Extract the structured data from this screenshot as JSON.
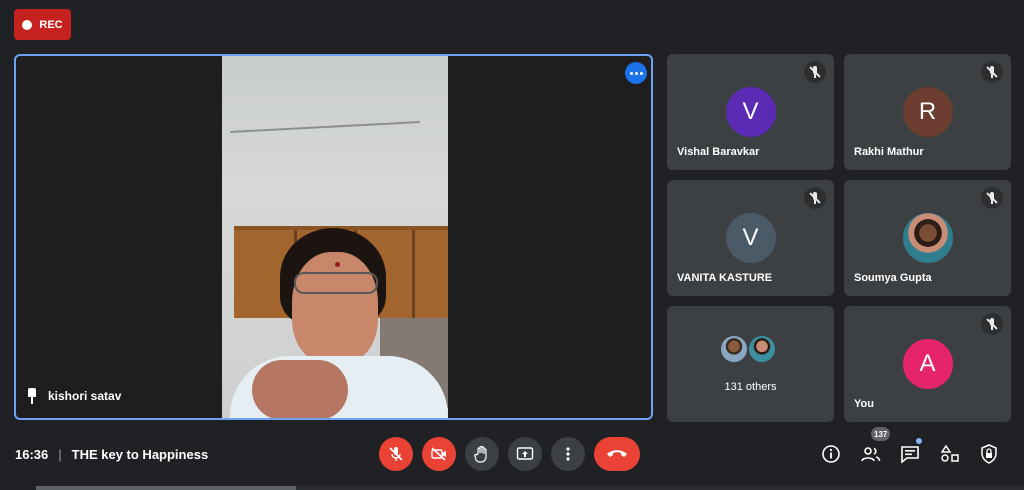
{
  "recording": {
    "label": "REC"
  },
  "main": {
    "presenter_name": "kishori satav",
    "more_options_icon": "more-horiz-icon",
    "pin_icon": "pin-icon"
  },
  "tiles": [
    {
      "name": "Vishal Baravkar",
      "initial": "V",
      "color": "#5b2bb5",
      "muted": true
    },
    {
      "name": "Rakhi Mathur",
      "initial": "R",
      "color": "#6b3c2f",
      "muted": true
    },
    {
      "name": "VANITA KASTURE",
      "initial": "V",
      "color": "#4a5a67",
      "muted": true
    },
    {
      "name": "Soumya Gupta",
      "initial": "",
      "color": "#2f7e8f",
      "muted": true
    },
    {
      "name": "",
      "initial": "",
      "others_text": "131 others",
      "muted": false
    },
    {
      "name": "You",
      "initial": "A",
      "color": "#e5246a",
      "muted": true
    }
  ],
  "bottom": {
    "time": "16:36",
    "separator": "|",
    "meeting_title": "THE key to Happiness",
    "controls": [
      "mic-off-icon",
      "camera-off-icon",
      "raise-hand-icon",
      "present-screen-icon",
      "more-vert-icon",
      "end-call-icon"
    ],
    "participants_count": "137",
    "right_icons": [
      "info-icon",
      "people-icon",
      "chat-icon",
      "activities-icon",
      "host-controls-icon"
    ]
  },
  "colors": {
    "background": "#202124",
    "tile": "#3c4043",
    "accent_blue": "#1a73e8",
    "danger_red": "#ea4335"
  }
}
